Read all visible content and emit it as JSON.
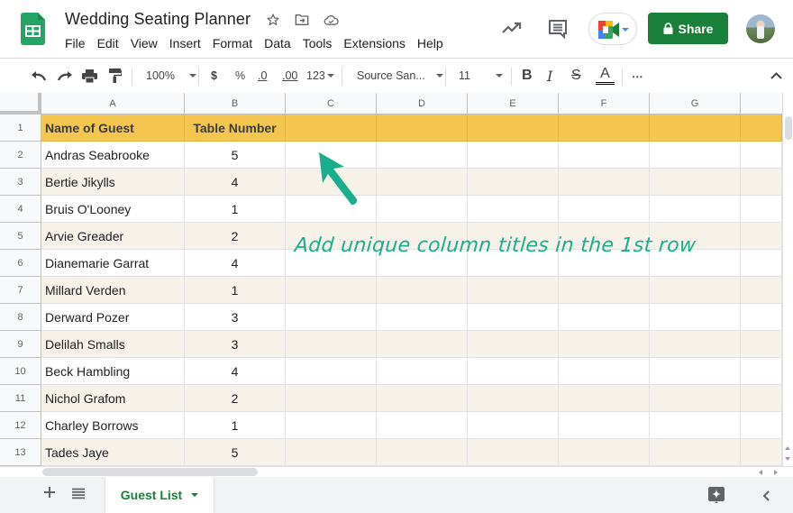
{
  "app": {
    "title": "Wedding Seating Planner",
    "title_icons": [
      "star-icon",
      "move-to-folder-icon",
      "cloud-saved-icon"
    ],
    "menu": [
      "File",
      "Edit",
      "View",
      "Insert",
      "Format",
      "Data",
      "Tools",
      "Extensions",
      "Help"
    ],
    "share_label": "Share",
    "brand_color": "#188038"
  },
  "toolbar": {
    "zoom": "100%",
    "currency": "$",
    "percent": "%",
    "decrease_decimal": ".0",
    "increase_decimal": ".00",
    "number_format": "123",
    "font": "Source San...",
    "font_size": "11",
    "bold": "B",
    "italic": "I",
    "strikethrough": "S",
    "text_color": "A",
    "more": "⋯"
  },
  "grid": {
    "columns": [
      "A",
      "B",
      "C",
      "D",
      "E",
      "F",
      "G"
    ],
    "header_color": "#f4c64f",
    "band_color": "#f6f1e9",
    "rows": [
      {
        "num": "1",
        "a": "Name of Guest",
        "b": "Table Number"
      },
      {
        "num": "2",
        "a": "Andras Seabrooke",
        "b": "5"
      },
      {
        "num": "3",
        "a": "Bertie Jikylls",
        "b": "4"
      },
      {
        "num": "4",
        "a": "Bruis O'Looney",
        "b": "1"
      },
      {
        "num": "5",
        "a": "Arvie Greader",
        "b": "2"
      },
      {
        "num": "6",
        "a": "Dianemarie Garrat",
        "b": "4"
      },
      {
        "num": "7",
        "a": "Millard Verden",
        "b": "1"
      },
      {
        "num": "8",
        "a": "Derward Pozer",
        "b": "3"
      },
      {
        "num": "9",
        "a": "Delilah Smalls",
        "b": "3"
      },
      {
        "num": "10",
        "a": "Beck Hambling",
        "b": "4"
      },
      {
        "num": "11",
        "a": "Nichol Grafom",
        "b": "2"
      },
      {
        "num": "12",
        "a": "Charley Borrows",
        "b": "1"
      },
      {
        "num": "13",
        "a": "Tades Jaye",
        "b": "5"
      }
    ]
  },
  "annotation": {
    "text": "Add unique column titles in the 1st row",
    "color": "#1aae8e"
  },
  "sheets": {
    "active": "Guest List"
  }
}
